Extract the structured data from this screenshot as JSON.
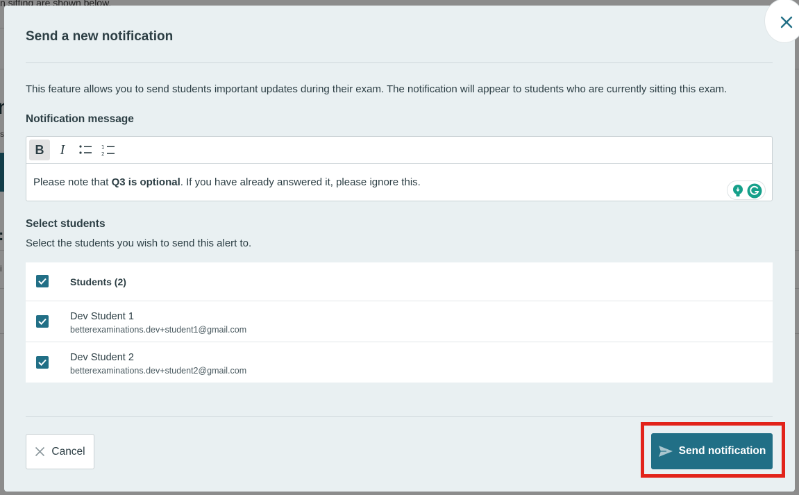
{
  "background": {
    "top_fragment": "n sitting are shown below."
  },
  "modal": {
    "title": "Send a new notification",
    "description": "This feature allows you to send students important updates during their exam. The notification will appear to students who are currently sitting this exam.",
    "message_label": "Notification message",
    "editor": {
      "toolbar": {
        "bold": "B",
        "italic": "I"
      },
      "content_before": "Please note that ",
      "content_bold": "Q3 is optional",
      "content_after": ". If you have already answered it, please ignore this."
    },
    "select_label": "Select students",
    "select_sub": "Select the students you wish to send this alert to.",
    "students_header": "Students (2)",
    "students": [
      {
        "name": "Dev Student 1",
        "email": "betterexaminations.dev+student1@gmail.com"
      },
      {
        "name": "Dev Student 2",
        "email": "betterexaminations.dev+student2@gmail.com"
      }
    ],
    "cancel_label": "Cancel",
    "send_label": "Send notification"
  },
  "colors": {
    "accent": "#216f86",
    "highlight": "#e2231a",
    "modal_bg": "#e9f0f2"
  }
}
